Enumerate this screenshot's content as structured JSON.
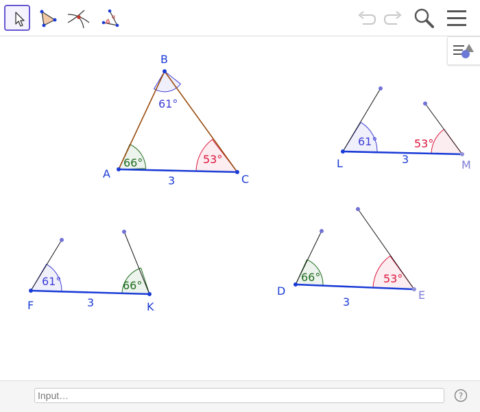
{
  "toolbar": {
    "tools": [
      "move-tool",
      "polygon-tool",
      "intersect-tool",
      "angle-tool"
    ],
    "undo": "undo",
    "redo": "redo",
    "search": "search",
    "menu": "menu"
  },
  "colors": {
    "blue": "#1a3bd6",
    "point": "#1a3bd6",
    "triangle_side": "#994c0f",
    "green": "#1e6c1e",
    "red": "#dc143c",
    "angle_blue": "#3c3cd6",
    "gray_label": "#7b7bd6"
  },
  "figures": {
    "triangle_abc": {
      "vertex_labels": [
        "A",
        "B",
        "C"
      ],
      "angle_a": "66°",
      "angle_b": "61°",
      "angle_c": "53°",
      "side_ac": "3"
    },
    "figure_lm": {
      "vertex_labels": [
        "L",
        "M"
      ],
      "angle_l": "61°",
      "angle_m": "53°",
      "side_lm": "3"
    },
    "figure_fk": {
      "vertex_labels": [
        "F",
        "K"
      ],
      "angle_f": "61°",
      "angle_k": "66°",
      "side_fk": "3"
    },
    "figure_de": {
      "vertex_labels": [
        "D",
        "E"
      ],
      "angle_d": "66°",
      "angle_e": "53°",
      "side_de": "3"
    }
  },
  "input_bar": {
    "placeholder": "Input…",
    "help": "?"
  }
}
